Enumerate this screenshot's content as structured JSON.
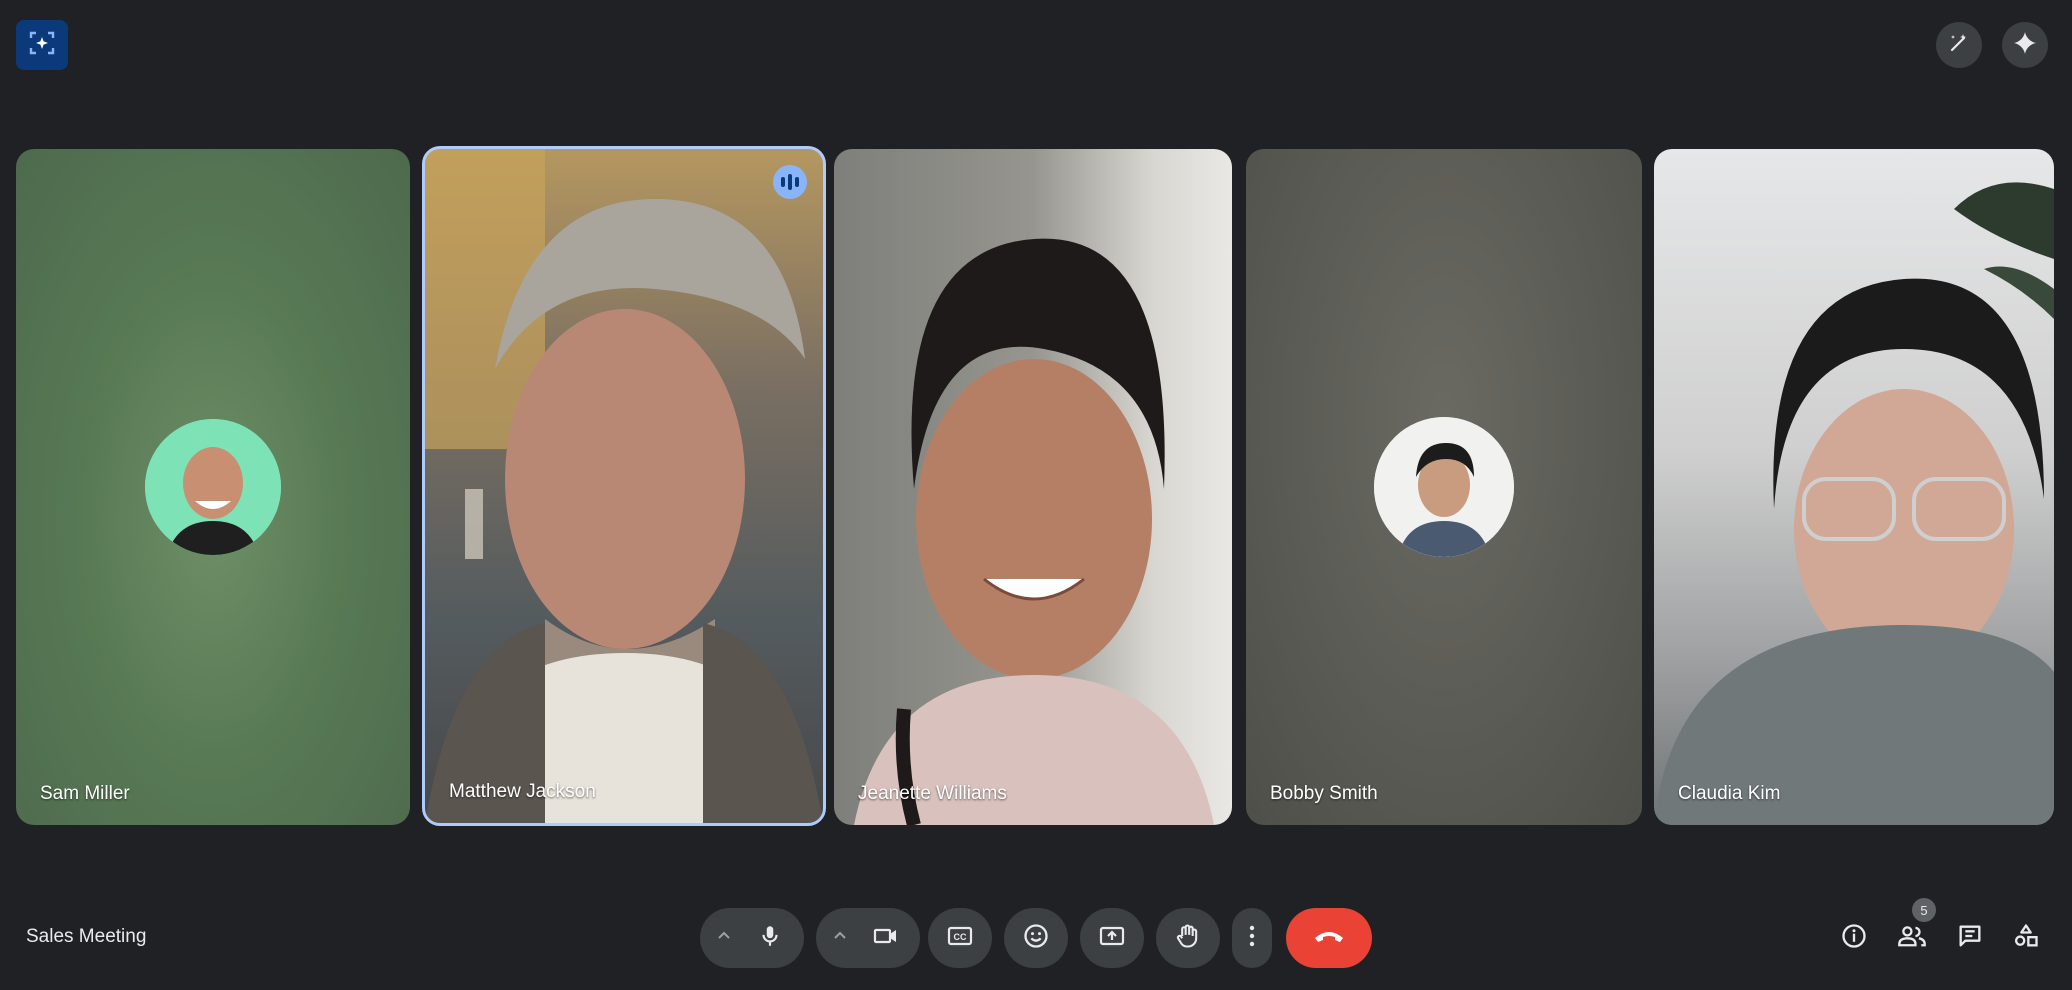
{
  "meeting": {
    "title": "Sales Meeting"
  },
  "participants": [
    {
      "name": "Sam Miller",
      "video": false
    },
    {
      "name": "Matthew Jackson",
      "video": true,
      "speaking": true
    },
    {
      "name": "Jeanette Williams",
      "video": true
    },
    {
      "name": "Bobby Smith",
      "video": false
    },
    {
      "name": "Claudia Kim",
      "video": true
    }
  ],
  "people_count": "5",
  "colors": {
    "accent": "#8ab4f8",
    "end_call": "#ea4335",
    "background": "#202124",
    "control": "#3c4043"
  },
  "icons": {
    "top_left": "framing-sparkle-icon",
    "top_right": [
      "magic-pen-icon",
      "sparkle-icon"
    ],
    "controls": [
      "chevron-up-icon",
      "mic-icon",
      "chevron-up-icon",
      "camera-icon",
      "captions-icon",
      "emoji-icon",
      "present-icon",
      "raise-hand-icon",
      "more-vert-icon",
      "end-call-icon"
    ],
    "right": [
      "info-icon",
      "people-icon",
      "chat-icon",
      "activities-icon"
    ]
  }
}
